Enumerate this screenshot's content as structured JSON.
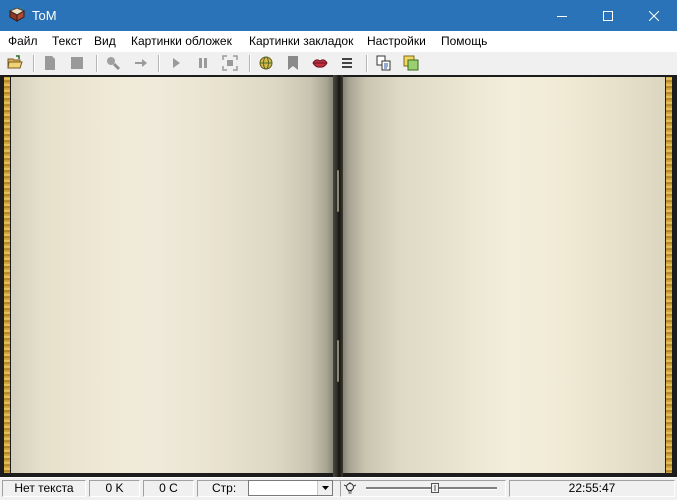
{
  "window": {
    "title": "ToM"
  },
  "menu": {
    "file": "Файл",
    "text": "Текст",
    "view": "Вид",
    "cover_images": "Картинки обложек",
    "bookmark_images": "Картинки закладок",
    "settings": "Настройки",
    "help": "Помощь"
  },
  "toolbar": {
    "icons": [
      "open-folder-icon",
      "page-icon",
      "stop-square-icon",
      "search-icon",
      "arrow-right-icon",
      "play-icon",
      "pause-icon",
      "fit-screen-icon",
      "globe-icon",
      "bookmark-icon",
      "lips-icon",
      "lines-icon",
      "copy-icon",
      "sticky-note-icon"
    ]
  },
  "status": {
    "text_state": "Нет текста",
    "size_k": "0 K",
    "count_c": "0 C",
    "page_label": "Стр:",
    "page_value": "",
    "time": "22:55:47",
    "speed_level": 0.53
  },
  "colors": {
    "titlebar": "#2b73b8",
    "page_paper": "#efe9d5",
    "page_edge_gold": "#d9b04a"
  }
}
